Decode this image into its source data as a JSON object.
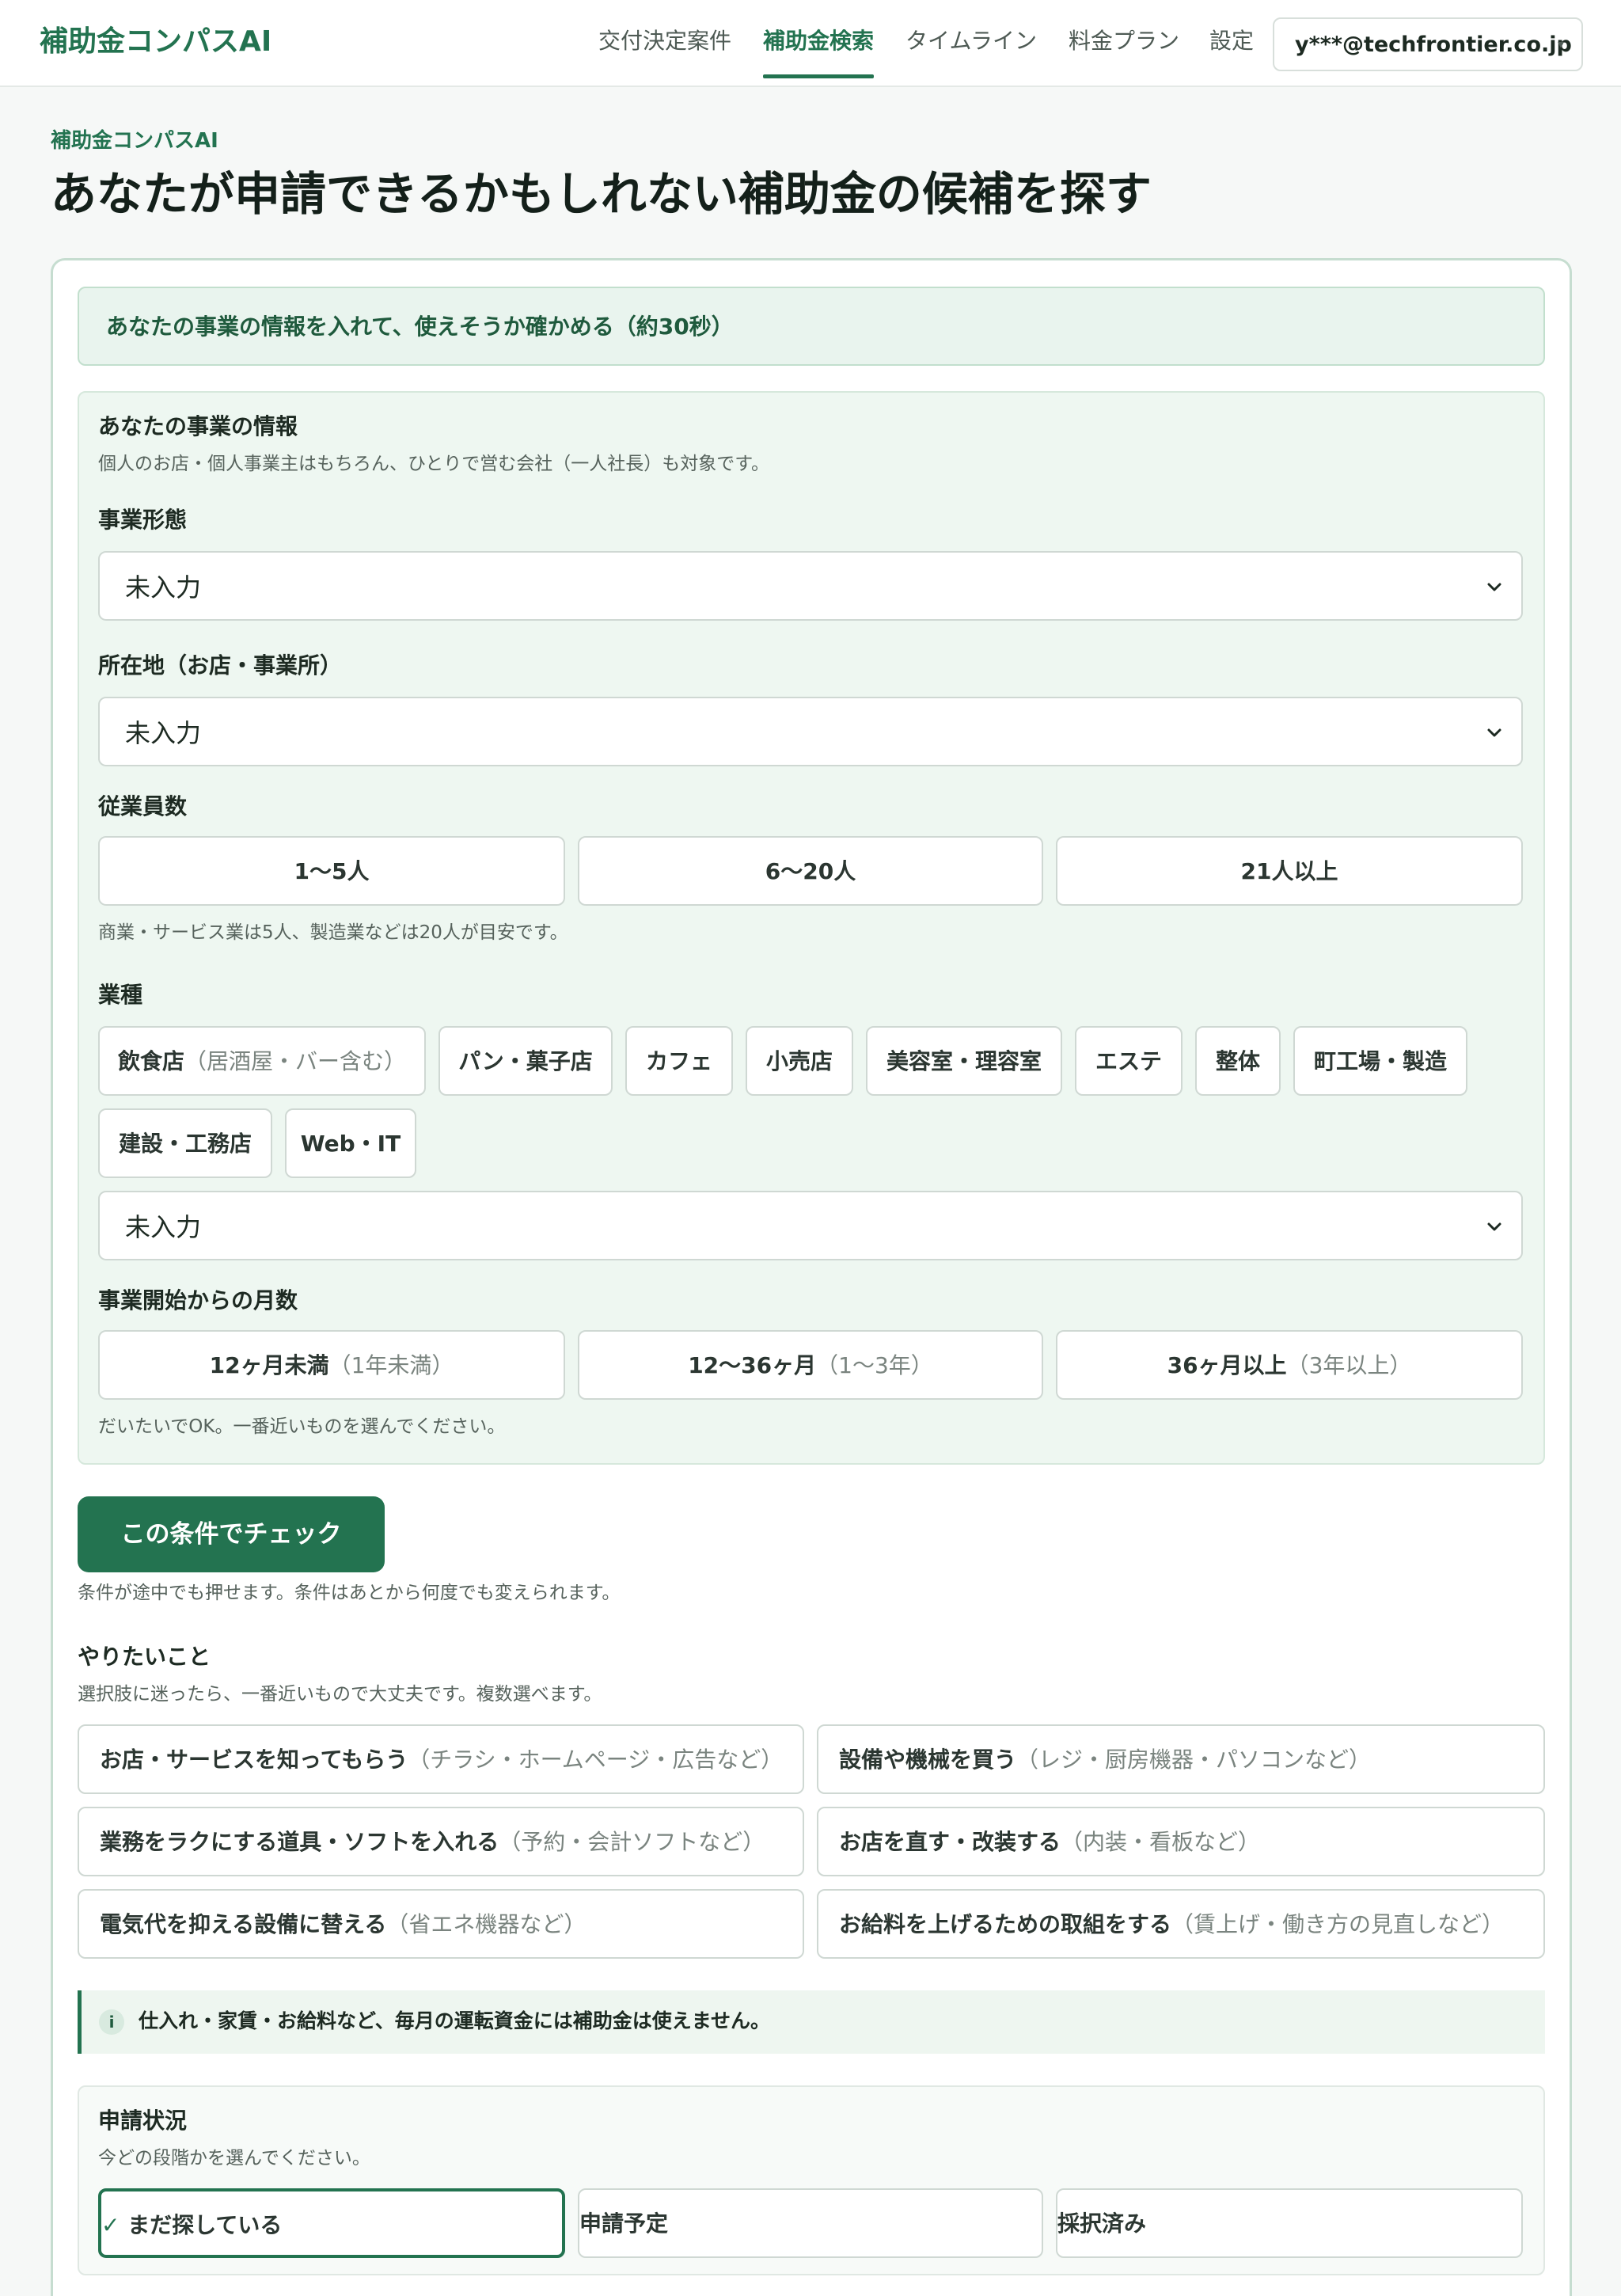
{
  "header": {
    "brand": "補助金コンパスAI",
    "nav": [
      "交付決定案件",
      "補助金検索",
      "タイムライン",
      "料金プラン",
      "設定"
    ],
    "active_nav": "補助金検索",
    "account": "y***@techfrontier.co.jp",
    "caret": "▾"
  },
  "page": {
    "eyebrow": "補助金コンパスAI",
    "title": "あなたが申請できるかもしれない補助金の候補を探す"
  },
  "intro": "あなたの事業の情報を入れて、使えそうか確かめる（約30秒）",
  "business": {
    "heading": "あなたの事業の情報",
    "description": "個人のお店・個人事業主はもちろん、ひとりで営む会社（一人社長）も対象です。",
    "form_label": "事業形態",
    "form_value": "未入力",
    "location_label": "所在地（お店・事業所）",
    "location_value": "未入力",
    "employees_label": "従業員数",
    "employees_options": [
      "1〜5人",
      "6〜20人",
      "21人以上"
    ],
    "employees_hint": "商業・サービス業は5人、製造業などは20人が目安です。",
    "industry_label": "業種",
    "industry_chips": [
      {
        "main": "飲食店",
        "sub": "（居酒屋・バー含む）"
      },
      {
        "main": "パン・菓子店",
        "sub": ""
      },
      {
        "main": "カフェ",
        "sub": ""
      },
      {
        "main": "小売店",
        "sub": ""
      },
      {
        "main": "美容室・理容室",
        "sub": ""
      },
      {
        "main": "エステ",
        "sub": ""
      },
      {
        "main": "整体",
        "sub": ""
      },
      {
        "main": "町工場・製造",
        "sub": ""
      },
      {
        "main": "建設・工務店",
        "sub": ""
      },
      {
        "main": "Web・IT",
        "sub": ""
      }
    ],
    "industry_value": "未入力",
    "months_label": "事業開始からの月数",
    "months_options": [
      {
        "main": "12ヶ月未満",
        "sub": "（1年未満）"
      },
      {
        "main": "12〜36ヶ月",
        "sub": "（1〜3年）"
      },
      {
        "main": "36ヶ月以上",
        "sub": "（3年以上）"
      }
    ],
    "months_hint": "だいたいでOK。一番近いものを選んでください。"
  },
  "check_button": "この条件でチェック",
  "check_hint": "条件が途中でも押せます。条件はあとから何度でも変えられます。",
  "goals": {
    "heading": "やりたいこと",
    "hint": "選択肢に迷ったら、一番近いもので大丈夫です。複数選べます。",
    "items": [
      {
        "main": "お店・サービスを知ってもらう",
        "sub": "（チラシ・ホームページ・広告など）"
      },
      {
        "main": "設備や機械を買う",
        "sub": "（レジ・厨房機器・パソコンなど）"
      },
      {
        "main": "業務をラクにする道具・ソフトを入れる",
        "sub": "（予約・会計ソフトなど）"
      },
      {
        "main": "お店を直す・改装する",
        "sub": "（内装・看板など）"
      },
      {
        "main": "電気代を抑える設備に替える",
        "sub": "（省エネ機器など）"
      },
      {
        "main": "お給料を上げるための取組をする",
        "sub": "（賃上げ・働き方の見直しなど）"
      }
    ]
  },
  "notice": {
    "icon": "i",
    "text": "仕入れ・家賃・お給料など、毎月の運転資金には補助金は使えません。"
  },
  "status": {
    "heading": "申請状況",
    "hint": "今どの段階かを選んでください。",
    "check_mark": "✓",
    "options": [
      "まだ探している",
      "申請予定",
      "採択済み"
    ],
    "selected": "まだ探している"
  },
  "colors": {
    "accent": "#237350",
    "section_bg": "#eef7f1",
    "intro_bg": "#e9f4ee"
  }
}
